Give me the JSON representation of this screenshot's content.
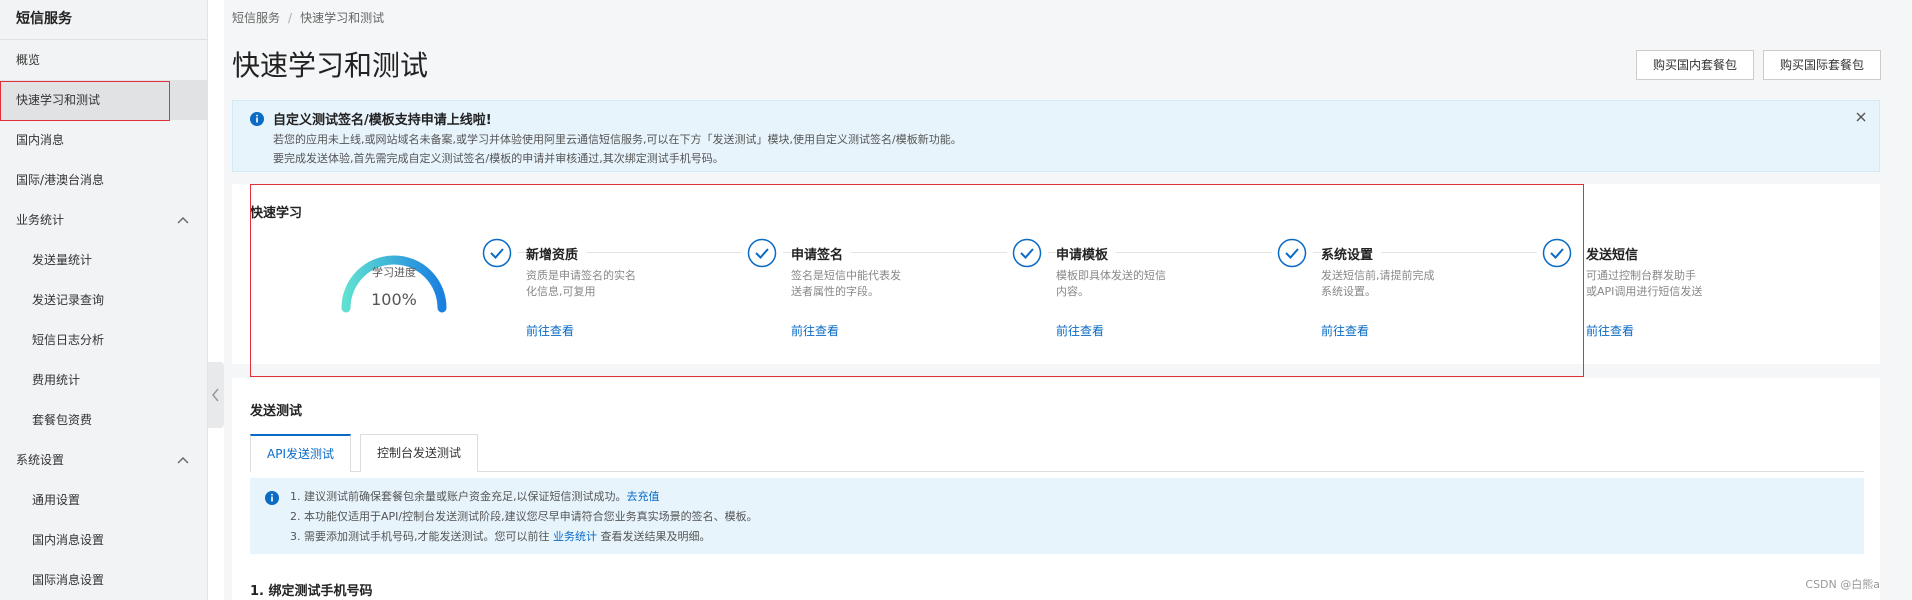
{
  "sidebar": {
    "title": "短信服务",
    "items": [
      {
        "label": "概览"
      },
      {
        "label": "快速学习和测试",
        "active": true
      },
      {
        "label": "国内消息"
      },
      {
        "label": "国际/港澳台消息"
      },
      {
        "label": "业务统计",
        "expanded": true
      },
      {
        "label": "发送量统计",
        "sub": true
      },
      {
        "label": "发送记录查询",
        "sub": true
      },
      {
        "label": "短信日志分析",
        "sub": true
      },
      {
        "label": "费用统计",
        "sub": true
      },
      {
        "label": "套餐包资费",
        "sub": true
      },
      {
        "label": "系统设置",
        "expanded": true
      },
      {
        "label": "通用设置",
        "sub": true
      },
      {
        "label": "国内消息设置",
        "sub": true
      },
      {
        "label": "国际消息设置",
        "sub": true
      }
    ]
  },
  "breadcrumb": {
    "root": "短信服务",
    "sep": "/",
    "current": "快速学习和测试"
  },
  "page_title": "快速学习和测试",
  "buttons": {
    "buy_domestic": "购买国内套餐包",
    "buy_international": "购买国际套餐包"
  },
  "notice": {
    "title": "自定义测试签名/模板支持申请上线啦!",
    "line1": "若您的应用未上线,或网站域名未备案,或学习并体验使用阿里云通信短信服务,可以在下方「发送测试」模块,使用自定义测试签名/模板新功能。",
    "line2": "要完成发送体验,首先需完成自定义测试签名/模板的申请并审核通过,其次绑定测试手机号码。"
  },
  "learn": {
    "title": "快速学习",
    "progress_label": "学习进度",
    "progress_value": "100%",
    "progress_fraction": 1.0,
    "steps": [
      {
        "title": "新增资质",
        "desc": "资质是申请签名的实名化信息,可复用",
        "link": "前往查看"
      },
      {
        "title": "申请签名",
        "desc": "签名是短信中能代表发送者属性的字段。",
        "link": "前往查看"
      },
      {
        "title": "申请模板",
        "desc": "模板即具体发送的短信内容。",
        "link": "前往查看"
      },
      {
        "title": "系统设置",
        "desc": "发送短信前,请提前完成系统设置。",
        "link": "前往查看"
      },
      {
        "title": "发送短信",
        "desc": "可通过控制台群发助手或API调用进行短信发送",
        "link": "前往查看"
      }
    ]
  },
  "send_test": {
    "title": "发送测试",
    "tabs": [
      {
        "label": "API发送测试",
        "active": true
      },
      {
        "label": "控制台发送测试"
      }
    ],
    "tip1_pre": "1. 建议测试前确保套餐包余量或账户资金充足,以保证短信测试成功。",
    "tip1_link": "去充值",
    "tip2": "2. 本功能仅适用于API/控制台发送测试阶段,建议您尽早申请符合您业务真实场景的签名、模板。",
    "tip3_pre": "3. 需要添加测试手机号码,才能发送测试。您可以前往",
    "tip3_link": "业务统计",
    "tip3_post": "查看发送结果及明细。",
    "bind_title": "1. 绑定测试手机号码"
  },
  "watermark": "CSDN @白熊a",
  "colors": {
    "accent": "#0a6bc5",
    "highlight_border": "#e0303a",
    "notice_bg": "#e7f4fc"
  }
}
